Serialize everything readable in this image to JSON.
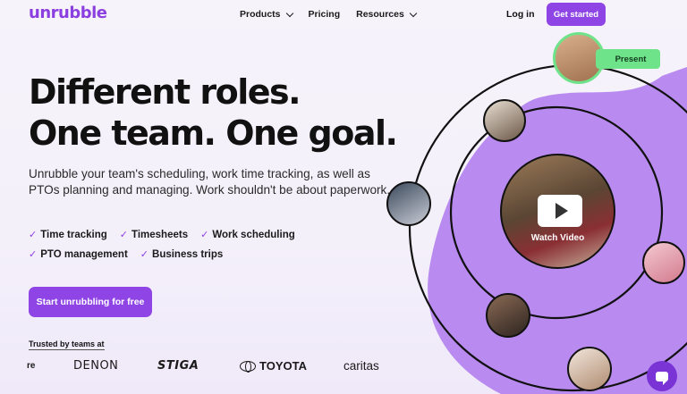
{
  "header": {
    "logo": "unrubble",
    "nav": [
      {
        "label": "Products",
        "has_dropdown": true
      },
      {
        "label": "Pricing",
        "has_dropdown": false
      },
      {
        "label": "Resources",
        "has_dropdown": true
      }
    ],
    "login": "Log in",
    "cta": "Get started"
  },
  "hero": {
    "headline_line1": "Different roles.",
    "headline_line2": "One team. One goal.",
    "subtitle": "Unrubble your team's scheduling, work time tracking, as well as PTOs planning and managing. Work shouldn't be about paperwork.",
    "features": [
      "Time tracking",
      "Timesheets",
      "Work scheduling",
      "PTO management",
      "Business trips"
    ],
    "cta": "Start unrubbling for free"
  },
  "trusted": {
    "label": "Trusted by teams at",
    "brands": [
      "re",
      "DENON",
      "STIGA",
      "TOYOTA",
      "caritas"
    ]
  },
  "visual": {
    "status_tag": "Present",
    "video_label": "Watch Video"
  },
  "colors": {
    "accent": "#8f45e6",
    "status_green": "#6fe38a",
    "blob": "#b98af0"
  }
}
